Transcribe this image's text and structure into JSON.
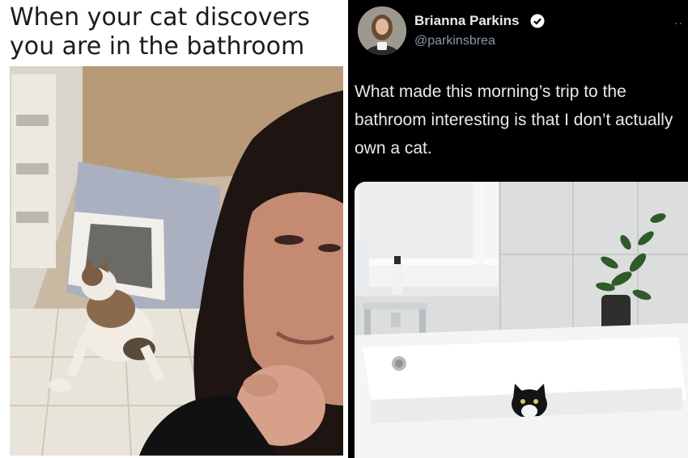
{
  "meme": {
    "caption_line1": "When your cat discovers",
    "caption_line2": "you are in the bathroom"
  },
  "tweet": {
    "author_name": "Brianna Parkins",
    "author_handle": "@parkinsbrea",
    "verified_icon": "verified-badge-icon",
    "more_icon": "more-options-icon",
    "text": "What made this morning’s trip to the bathroom interesting is that I don’t actually own a cat."
  },
  "colors": {
    "tweet_background": "#000000",
    "tweet_text": "#e7e9ea",
    "handle": "#8b98a5",
    "verified": "#1d9bf0"
  }
}
